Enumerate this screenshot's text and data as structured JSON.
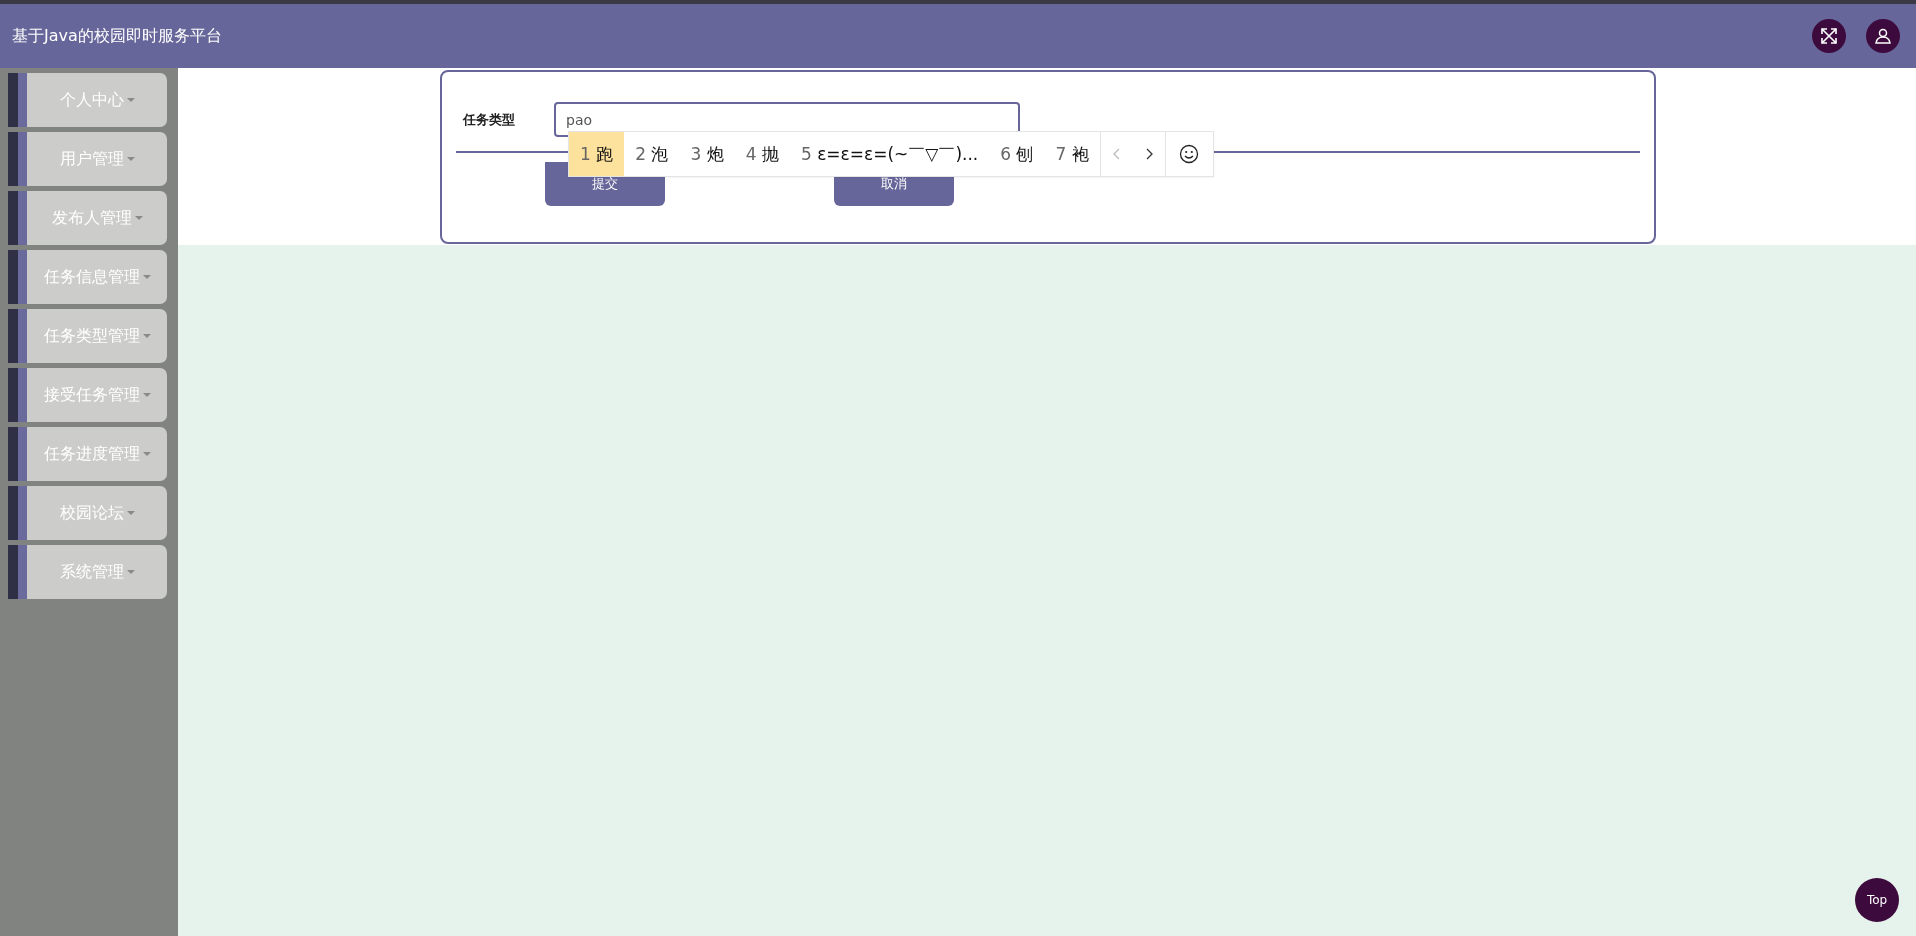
{
  "header": {
    "title": "基于Java的校园即时服务平台"
  },
  "sidebar": {
    "items": [
      {
        "label": "个人中心"
      },
      {
        "label": "用户管理"
      },
      {
        "label": "发布人管理"
      },
      {
        "label": "任务信息管理"
      },
      {
        "label": "任务类型管理"
      },
      {
        "label": "接受任务管理"
      },
      {
        "label": "任务进度管理"
      },
      {
        "label": "校园论坛"
      },
      {
        "label": "系统管理"
      }
    ]
  },
  "form": {
    "field_label": "任务类型",
    "field_value": "pao",
    "buttons": [
      "提交",
      "取消"
    ]
  },
  "ime": {
    "candidates": [
      {
        "number": "1",
        "text": "跑",
        "selected": true
      },
      {
        "number": "2",
        "text": "泡",
        "selected": false
      },
      {
        "number": "3",
        "text": "炮",
        "selected": false
      },
      {
        "number": "4",
        "text": "抛",
        "selected": false
      },
      {
        "number": "5",
        "text": "ε=ε=ε=(~￣▽￣)...",
        "selected": false
      },
      {
        "number": "6",
        "text": "刨",
        "selected": false
      },
      {
        "number": "7",
        "text": "袍",
        "selected": false
      }
    ],
    "prev_disabled": true,
    "next_disabled": false
  },
  "top_button": {
    "label": "Top"
  }
}
